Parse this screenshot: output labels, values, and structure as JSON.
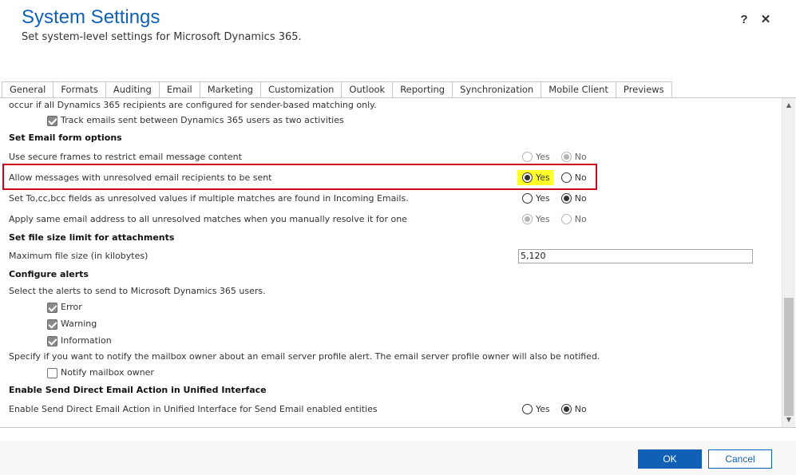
{
  "header": {
    "title": "System Settings",
    "subtitle": "Set system-level settings for Microsoft Dynamics 365.",
    "help_label": "?",
    "close_label": "✕"
  },
  "tabs": [
    {
      "label": "General"
    },
    {
      "label": "Formats"
    },
    {
      "label": "Auditing"
    },
    {
      "label": "Email",
      "active": true
    },
    {
      "label": "Marketing"
    },
    {
      "label": "Customization"
    },
    {
      "label": "Outlook"
    },
    {
      "label": "Reporting"
    },
    {
      "label": "Synchronization"
    },
    {
      "label": "Mobile Client"
    },
    {
      "label": "Previews"
    }
  ],
  "content": {
    "truncated_text": "occur if all Dynamics 365 recipients are configured for sender-based matching only.",
    "track_emails_label": "Track emails sent between Dynamics 365 users as two activities",
    "section_email_form": "Set Email form options",
    "secure_frames": {
      "label": "Use secure frames to restrict email message content",
      "selected": "No",
      "disabled": true
    },
    "unresolved_recipients": {
      "label": "Allow messages with unresolved email recipients to be sent",
      "selected": "Yes",
      "disabled": false
    },
    "unresolved_values": {
      "label": "Set To,cc,bcc fields as unresolved values if multiple matches are found in Incoming Emails.",
      "selected": "No",
      "disabled": false
    },
    "same_address": {
      "label": "Apply same email address to all unresolved matches when you manually resolve it for one",
      "selected": "Yes",
      "disabled": true
    },
    "yes_label": "Yes",
    "no_label": "No",
    "section_file_size": "Set file size limit for attachments",
    "max_file_size_label": "Maximum file size (in kilobytes)",
    "max_file_size_value": "5,120",
    "section_alerts": "Configure alerts",
    "alerts_intro": "Select the alerts to send to Microsoft Dynamics 365 users.",
    "alert_error": "Error",
    "alert_warning": "Warning",
    "alert_information": "Information",
    "mailbox_notify_text": "Specify if you want to notify the mailbox owner about an email server profile alert. The email server profile owner will also be notified.",
    "notify_mailbox_label": "Notify mailbox owner",
    "section_direct_email": "Enable Send Direct Email Action in Unified Interface",
    "direct_email": {
      "label": "Enable Send Direct Email Action in Unified Interface for Send Email enabled entities",
      "selected": "No",
      "disabled": false
    }
  },
  "footer": {
    "ok_label": "OK",
    "cancel_label": "Cancel"
  },
  "colors": {
    "accent": "#1160b7",
    "highlight": "#ffff2a",
    "annotation": "#d0021b"
  }
}
